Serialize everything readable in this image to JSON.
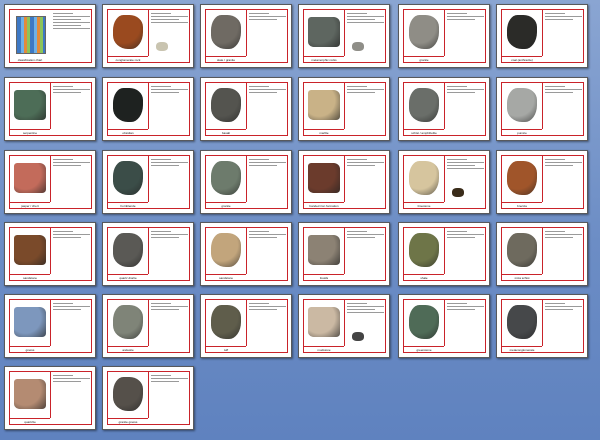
{
  "cards": [
    {
      "label": "classification chart",
      "color": "#4a8fd6",
      "title": true
    },
    {
      "label": "conglomerate rock",
      "color": "#9a4a1f",
      "extra": "#c9c4b0"
    },
    {
      "label": "slate / granite",
      "color": "#6f6a63"
    },
    {
      "label": "metamorphic rocks",
      "color": "#5e6660",
      "extra": "#8f8e88"
    },
    {
      "label": "granite",
      "color": "#8f8d86"
    },
    {
      "label": "coal (anthracite)",
      "color": "#2b2b28"
    },
    {
      "label": "serpentine",
      "color": "#4d6d57"
    },
    {
      "label": "obsidian",
      "color": "#1e2220"
    },
    {
      "label": "basalt",
      "color": "#54544f"
    },
    {
      "label": "marble",
      "color": "#c9b287"
    },
    {
      "label": "schist / amphibolite",
      "color": "#6a6e69"
    },
    {
      "label": "pumice",
      "color": "#a6a8a5"
    },
    {
      "label": "jasper / chert",
      "color": "#c36b5b"
    },
    {
      "label": "hornblende",
      "color": "#3b4d48"
    },
    {
      "label": "granite",
      "color": "#6d7b6c"
    },
    {
      "label": "banded iron formation",
      "color": "#6b3b2c"
    },
    {
      "label": "limestone",
      "color": "#d6c59e",
      "extra": "#3a2c1a"
    },
    {
      "label": "breccia",
      "color": "#a0552a"
    },
    {
      "label": "sandstone",
      "color": "#7a4a2a"
    },
    {
      "label": "quartz diorite",
      "color": "#5a5955"
    },
    {
      "label": "sandstone",
      "color": "#c2a57c"
    },
    {
      "label": "fossils",
      "color": "#8c8274"
    },
    {
      "label": "shale",
      "color": "#6e7548"
    },
    {
      "label": "mica schist",
      "color": "#6e6a5e"
    },
    {
      "label": "gneiss",
      "color": "#7d97bd"
    },
    {
      "label": "andesite",
      "color": "#7f8478"
    },
    {
      "label": "tuff",
      "color": "#5f5d4b"
    },
    {
      "label": "mudstone",
      "color": "#cbb9a3",
      "extra": "#444"
    },
    {
      "label": "greenstone",
      "color": "#4f6b57"
    },
    {
      "label": "metaconglomerate",
      "color": "#46484a"
    },
    {
      "label": "quartzite",
      "color": "#b48b72"
    },
    {
      "label": "granite gneiss",
      "color": "#55504a"
    }
  ]
}
